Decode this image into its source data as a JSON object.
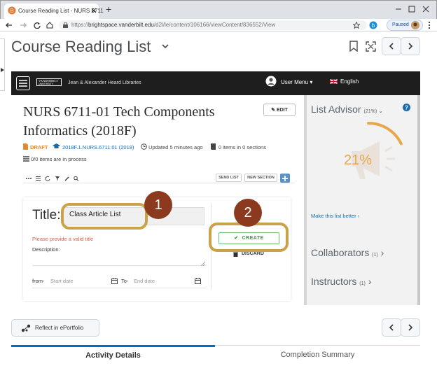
{
  "browser": {
    "tab_title": "Course Reading List - NURS 6711",
    "new_tab_symbol": "+",
    "url_scheme": "https://",
    "url_host": "brightspace.vanderbilt.edu",
    "url_path": "/d2l/le/content/106166/viewContent/836552/View",
    "paused_label": "Paused"
  },
  "page": {
    "title": "Course Reading List"
  },
  "library_bar": {
    "brand": "VANDERBILT",
    "brand_sub": "UNIVERSITY",
    "library_name": "Jean & Alexander Heard Libraries",
    "user_menu": "User Menu",
    "language": "English"
  },
  "list": {
    "title": "NURS 6711-01 Tech Components Informatics (2018F)",
    "edit_label": "EDIT",
    "status": "DRAFT",
    "course_code": "2018F.1.NURS.6711.01 (2018)",
    "updated": "Updated 5 minutes ago",
    "items_count": "0 items in 0 sections",
    "in_process": "0/0 items are in process",
    "send_list": "SEND LIST",
    "new_section": "NEW SECTION"
  },
  "form": {
    "title_label": "Title:",
    "title_value": "Class Article List",
    "error": "Please provide a valid title",
    "description_label": "Description:",
    "from_label": "from-",
    "start_placeholder": "Start date",
    "to_label": "To-",
    "end_placeholder": "End date",
    "create_label": "CREATE",
    "discard_label": "DISCARD"
  },
  "callouts": {
    "one": "1",
    "two": "2"
  },
  "advisor": {
    "title": "List Advisor",
    "pct_small": "(21%)",
    "percent": "21%",
    "progress": 0.21,
    "make_better": "Make this list better",
    "collaborators": "Collaborators",
    "collaborators_count": "(1)",
    "instructors": "Instructors",
    "instructors_count": "(1)"
  },
  "bottom": {
    "eportfolio": "Reflect in ePortfolio",
    "tab_activity": "Activity Details",
    "tab_completion": "Completion Summary"
  },
  "colors": {
    "callout_border": "#c9a24a",
    "callout_fill": "#8b3a1f",
    "advisor_orange": "#e7a84c",
    "draft_orange": "#e8872c",
    "error_red": "#e05d4b",
    "create_green": "#3c9a3c"
  },
  "icons": [
    "brightspace-favicon",
    "back-icon",
    "forward-icon",
    "reload-icon",
    "lock-icon",
    "star-icon",
    "extension-icon",
    "menu-icon",
    "bookmark-icon",
    "fullscreen-icon",
    "chevron-left-icon",
    "chevron-right-icon",
    "hamburger-icon",
    "user-avatar-icon",
    "flag-icon",
    "pencil-icon",
    "draft-icon",
    "mortarboard-icon",
    "clock-icon",
    "book-icon",
    "stack-icon",
    "calendar-icon",
    "check-icon",
    "trash-icon",
    "megaphone-icon",
    "help-icon",
    "reflect-icon"
  ]
}
